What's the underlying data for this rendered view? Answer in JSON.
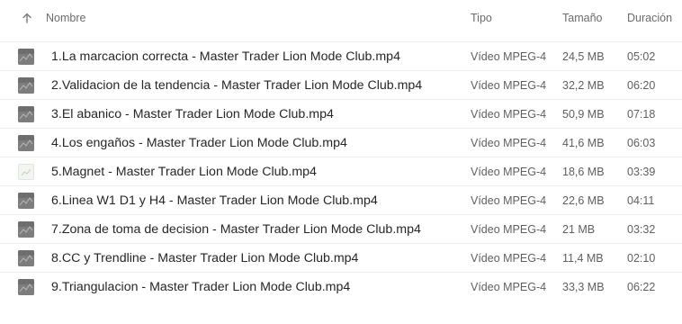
{
  "table": {
    "headers": {
      "name": "Nombre",
      "type": "Tipo",
      "size": "Tamaño",
      "duration": "Duración"
    },
    "sort_icon": "arrow-up-icon",
    "files": [
      {
        "name": "1.La marcacion correcta - Master Trader Lion Mode Club.mp4",
        "type": "Vídeo MPEG-4",
        "size": "24,5 MB",
        "duration": "05:02",
        "thumb": "video-thumbnail-icon"
      },
      {
        "name": "2.Validacion de la tendencia - Master Trader Lion Mode Club.mp4",
        "type": "Vídeo MPEG-4",
        "size": "32,2 MB",
        "duration": "06:20",
        "thumb": "video-thumbnail-icon"
      },
      {
        "name": "3.El abanico - Master Trader Lion Mode Club.mp4",
        "type": "Vídeo MPEG-4",
        "size": "50,9 MB",
        "duration": "07:18",
        "thumb": "video-thumbnail-icon"
      },
      {
        "name": "4.Los engaños - Master Trader Lion Mode Club.mp4",
        "type": "Vídeo MPEG-4",
        "size": "41,6 MB",
        "duration": "06:03",
        "thumb": "video-thumbnail-icon"
      },
      {
        "name": "5.Magnet - Master Trader Lion Mode Club.mp4",
        "type": "Vídeo MPEG-4",
        "size": "18,6 MB",
        "duration": "03:39",
        "thumb": "video-thumbnail-light-icon"
      },
      {
        "name": "6.Linea W1 D1 y H4 - Master Trader Lion Mode Club.mp4",
        "type": "Vídeo MPEG-4",
        "size": "22,6 MB",
        "duration": "04:11",
        "thumb": "video-thumbnail-icon"
      },
      {
        "name": "7.Zona de toma de decision - Master Trader Lion Mode Club.mp4",
        "type": "Vídeo MPEG-4",
        "size": "21 MB",
        "duration": "03:32",
        "thumb": "video-thumbnail-icon"
      },
      {
        "name": "8.CC y Trendline - Master Trader Lion Mode Club.mp4",
        "type": "Vídeo MPEG-4",
        "size": "11,4 MB",
        "duration": "02:10",
        "thumb": "video-thumbnail-icon"
      },
      {
        "name": "9.Triangulacion - Master Trader Lion Mode Club.mp4",
        "type": "Vídeo MPEG-4",
        "size": "33,3 MB",
        "duration": "06:22",
        "thumb": "video-thumbnail-icon"
      }
    ]
  }
}
